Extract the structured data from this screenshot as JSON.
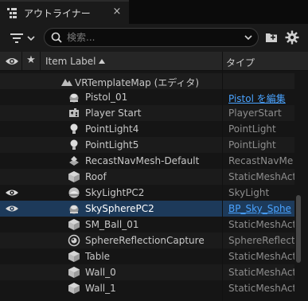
{
  "tab": {
    "title": "アウトライナー",
    "close_glyph": "×"
  },
  "toolbar": {
    "search_placeholder": "検索..."
  },
  "header": {
    "star_glyph": "★",
    "item_label": "Item Label",
    "type_label": "タイプ"
  },
  "world": {
    "name": "VRTemplateMap (エディタ)"
  },
  "rows": [
    {
      "name": "Pistol_01",
      "type": "Pistol を編集",
      "type_link": true,
      "icon": "pistol-mesh-icon",
      "visible": false,
      "selected": false
    },
    {
      "name": "Player Start",
      "type": "PlayerStart",
      "type_link": false,
      "icon": "player-start-icon",
      "visible": false,
      "selected": false
    },
    {
      "name": "PointLight4",
      "type": "PointLight",
      "type_link": false,
      "icon": "point-light-icon",
      "visible": false,
      "selected": false
    },
    {
      "name": "PointLight5",
      "type": "PointLight",
      "type_link": false,
      "icon": "point-light-icon",
      "visible": false,
      "selected": false
    },
    {
      "name": "RecastNavMesh-Default",
      "type": "RecastNavMe",
      "type_link": false,
      "icon": "navmesh-icon",
      "visible": false,
      "selected": false
    },
    {
      "name": "Roof",
      "type": "StaticMeshAct",
      "type_link": false,
      "icon": "static-mesh-icon",
      "visible": false,
      "selected": false
    },
    {
      "name": "SkyLightPC2",
      "type": "SkyLight",
      "type_link": false,
      "icon": "sky-light-icon",
      "visible": true,
      "selected": false
    },
    {
      "name": "SkySpherePC2",
      "type": "BP_Sky_Sphe",
      "type_link": true,
      "icon": "sky-sphere-icon",
      "visible": true,
      "selected": true
    },
    {
      "name": "SM_Ball_01",
      "type": "StaticMeshAct",
      "type_link": false,
      "icon": "static-mesh-icon",
      "visible": false,
      "selected": false
    },
    {
      "name": "SphereReflectionCapture",
      "type": "SphereReflect",
      "type_link": false,
      "icon": "reflection-capture-icon",
      "visible": false,
      "selected": false
    },
    {
      "name": "Table",
      "type": "StaticMeshAct",
      "type_link": false,
      "icon": "static-mesh-icon",
      "visible": false,
      "selected": false
    },
    {
      "name": "Wall_0",
      "type": "StaticMeshAct",
      "type_link": false,
      "icon": "static-mesh-icon",
      "visible": false,
      "selected": false
    },
    {
      "name": "Wall_1",
      "type": "StaticMeshAct",
      "type_link": false,
      "icon": "static-mesh-icon",
      "visible": false,
      "selected": false
    }
  ],
  "colors": {
    "background": "#151515",
    "header": "#262626",
    "selected_row": "#1d3a5a",
    "link": "#4aa3ff",
    "type_text": "#8d8d8d"
  }
}
